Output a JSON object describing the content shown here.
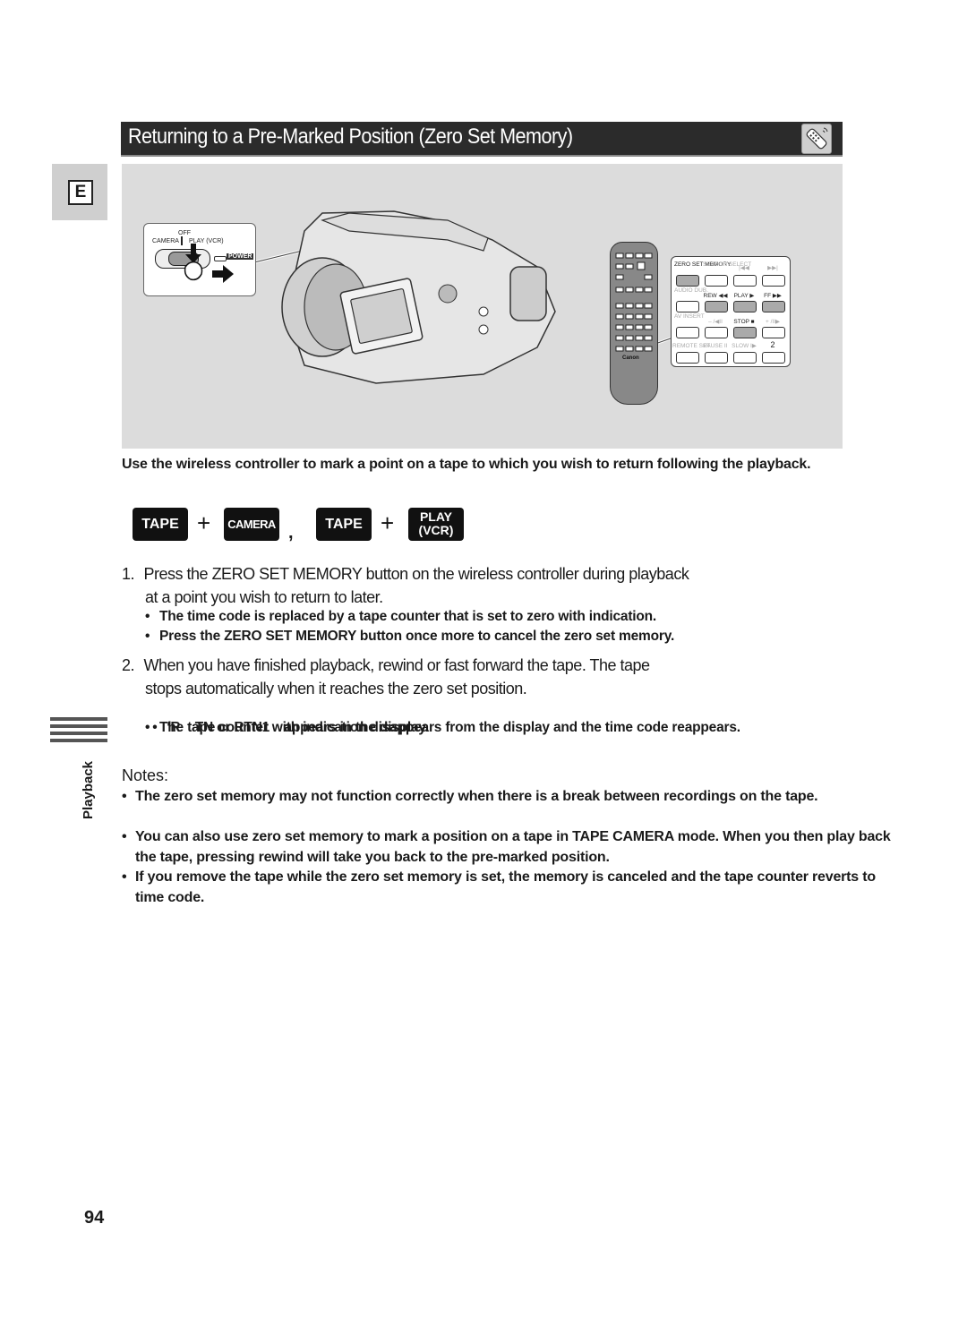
{
  "header": {
    "title": "Returning to a Pre-Marked Position (Zero Set Memory)",
    "icon": "wireless-controller-icon"
  },
  "language_tab": {
    "label": "E"
  },
  "illustration": {
    "switch_panel": {
      "off_label": "OFF",
      "camera_label": "CAMERA",
      "play_label": "PLAY (VCR)",
      "power_label": "POWER"
    },
    "remote_brand": "Canon",
    "remote_buttons": [
      {
        "label": "ZERO SET MEMORY",
        "highlight": true,
        "dim": false
      },
      {
        "label": "SEARCH SELECT",
        "highlight": false,
        "dim": true
      },
      {
        "label": "|◀◀",
        "highlight": false,
        "dim": true
      },
      {
        "label": "▶▶|",
        "highlight": false,
        "dim": true
      },
      {
        "label": "AUDIO DUB.",
        "highlight": false,
        "dim": true
      },
      {
        "label": "REW ◀◀",
        "highlight": true,
        "dim": false
      },
      {
        "label": "PLAY ▶",
        "highlight": true,
        "dim": false
      },
      {
        "label": "FF ▶▶",
        "highlight": true,
        "dim": false
      },
      {
        "label": "AV INSERT",
        "highlight": false,
        "dim": true
      },
      {
        "label": "– /◀II",
        "highlight": false,
        "dim": true
      },
      {
        "label": "STOP ■",
        "highlight": true,
        "dim": false
      },
      {
        "label": "+ /II▶",
        "highlight": false,
        "dim": true
      },
      {
        "label": "REMOTE SET",
        "highlight": false,
        "dim": true
      },
      {
        "label": "PAUSE II",
        "highlight": false,
        "dim": true
      },
      {
        "label": "SLOW I▶",
        "highlight": false,
        "dim": true
      },
      {
        "label": "2",
        "highlight": false,
        "dim": false
      }
    ]
  },
  "intro": "Use the wireless controller to mark a point on a tape to which you wish to return following the playback.",
  "mode_keys": {
    "k1": "TAPE",
    "plus": "+",
    "k2": "CAMERA",
    "separator": ",",
    "k3": "TAPE",
    "k4_line1": "PLAY",
    "k4_line2": "(VCR)"
  },
  "steps": [
    {
      "number": "1.",
      "line1": "Press the ZERO SET MEMORY button on the wireless controller during playback",
      "line2": "at a point you wish to return to later.",
      "bullets": [
        "The time code is replaced by a tape counter that is set to zero with indication.",
        "Press the ZERO SET MEMORY button once more to cancel the zero set memory."
      ]
    },
    {
      "number": "2.",
      "line1": "When you have finished playback, rewind or fast forward the tape. The tape",
      "line2": "stops automatically when it reaches the zero set position.",
      "bullets": [
        "‘R    TN or RTN1    appears in the display.",
        "The tape counter with indication disappears from the display and the time code reappears."
      ]
    }
  ],
  "sidebar": {
    "section_label": "Playback"
  },
  "notes": {
    "title": "Notes:",
    "items": [
      "The zero set memory may not function correctly when there is a break between recordings on the tape.",
      "You can also use zero set memory to mark a position on a tape in TAPE CAMERA mode. When you then play back the tape, pressing rewind will take you back to the pre-marked position.",
      "If you remove the tape while the zero set memory is set, the memory is canceled and the tape counter reverts to time code."
    ]
  },
  "page_number": "94",
  "bullet_char": "•"
}
